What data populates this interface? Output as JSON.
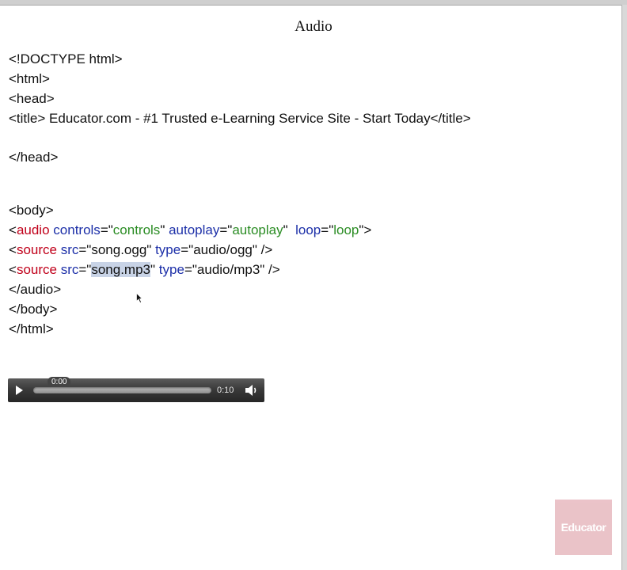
{
  "slide": {
    "title": "Audio"
  },
  "code": {
    "l1": "<!DOCTYPE html>",
    "l2": "<html>",
    "l3": "<head>",
    "l4": "<title> Educator.com - #1 Trusted e-Learning Service Site - Start Today</title>",
    "l5": "</head>",
    "l6": "<body>",
    "l7": {
      "lt": "<",
      "tag": "audio",
      "sp1": " ",
      "a1": "controls",
      "eq1": "=\"",
      "v1": "controls",
      "q1": "\"",
      "sp2": " ",
      "a2": "autoplay",
      "eq2": "=\"",
      "v2": "autoplay",
      "q2": "\"",
      "sp3": "  ",
      "a3": "loop",
      "eq3": "=\"",
      "v3": "loop",
      "q3": "\">"
    },
    "l8": {
      "lt": "<",
      "tag": "source",
      "sp1": " ",
      "a1": "src",
      "eq1": "=\"",
      "v1": "song.ogg",
      "q1": "\"",
      "sp2": " ",
      "a2": "type",
      "eq2": "=\"",
      "v2": "audio/ogg",
      "q2": "\" />"
    },
    "l9": {
      "lt": "<",
      "tag": "source",
      "sp1": " ",
      "a1": "src",
      "eq1": "=\"",
      "v1": "song.mp3",
      "q1": "\"",
      "sp2": " ",
      "a2": "type",
      "eq2": "=\"",
      "v2": "audio/mp3",
      "q2": "\" />"
    },
    "l10": "</audio>",
    "l11": "</body>",
    "l12": "</html>"
  },
  "player": {
    "current_time": "0:00",
    "duration": "0:10",
    "progress": 0.0,
    "play_icon": "play-icon",
    "volume_icon": "speaker-icon"
  },
  "watermark": {
    "logo": "Educator"
  },
  "colors": {
    "tag": "#c0001a",
    "attribute": "#1c2fa8",
    "value": "#2a8c23",
    "selection": "#c8d3e6",
    "logo_bg": "#e7b9bf"
  }
}
